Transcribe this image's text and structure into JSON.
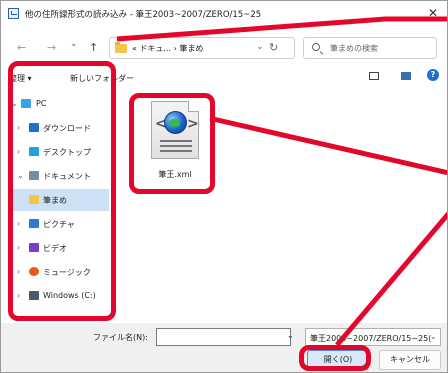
{
  "title": "他の住所録形式の読み込み - 筆王2003~2007/ZERO/15~25",
  "nav": {
    "back": "←",
    "forward": "→",
    "dropdown": "⌄",
    "up": "↑"
  },
  "address": {
    "path": "« ドキュ... › 筆まめ",
    "dropdown": "⌄"
  },
  "refresh": "↻",
  "search": {
    "placeholder": "筆まめの検索"
  },
  "cmdbar": {
    "organize": "整理 ▾",
    "new_folder": "新しいフォルダー"
  },
  "sidebar": [
    {
      "label": "PC",
      "chev": "⌄",
      "icon": "pc-icon",
      "color": "#3aa3e8",
      "selected": false
    },
    {
      "label": "ダウンロード",
      "chev": "›",
      "icon": "download-icon",
      "color": "#1f6fd1",
      "selected": false
    },
    {
      "label": "デスクトップ",
      "chev": "›",
      "icon": "desktop-icon",
      "color": "#22a3d8",
      "selected": false
    },
    {
      "label": "ドキュメント",
      "chev": "⌄",
      "icon": "documents-icon",
      "color": "#7a8aa0",
      "selected": false
    },
    {
      "label": "筆まめ",
      "chev": "",
      "icon": "folder-icon",
      "color": "#f3c54a",
      "selected": true
    },
    {
      "label": "ピクチャ",
      "chev": "›",
      "icon": "pictures-icon",
      "color": "#2d78d8",
      "selected": false
    },
    {
      "label": "ビデオ",
      "chev": "›",
      "icon": "videos-icon",
      "color": "#7b3fc4",
      "selected": false
    },
    {
      "label": "ミュージック",
      "chev": "›",
      "icon": "music-icon",
      "color": "#e35a1f",
      "selected": false
    },
    {
      "label": "Windows (C:)",
      "chev": "›",
      "icon": "drive-icon",
      "color": "#4c5868",
      "selected": false
    }
  ],
  "file": {
    "name": "筆王.xml",
    "icon": "xml-file-icon"
  },
  "bottom": {
    "filename_label": "ファイル名(N):",
    "filename_value": "",
    "filter": "筆王2003~2007/ZERO/15~25(",
    "open": "開く(O)",
    "cancel": "キャンセル"
  },
  "colors": {
    "highlight": "#e3082b",
    "selection": "#cde0f6",
    "accent": "#1f6fd1"
  }
}
